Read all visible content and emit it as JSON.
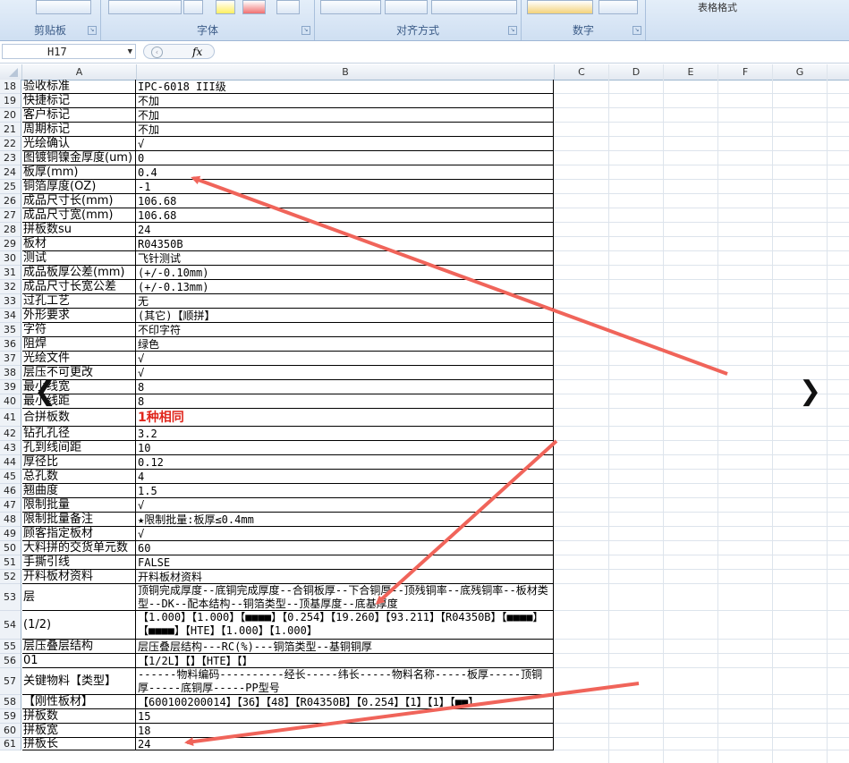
{
  "ribbon": {
    "groups": [
      {
        "label": "剪贴板"
      },
      {
        "label": "字体"
      },
      {
        "label": "对齐方式"
      },
      {
        "label": "数字"
      },
      {
        "label": "表格格式"
      }
    ]
  },
  "formula_bar": {
    "name_box": "H17",
    "fx_label": "fx",
    "value": ""
  },
  "columns": [
    "A",
    "B",
    "C",
    "D",
    "E",
    "F",
    "G"
  ],
  "rows": [
    {
      "num": "18",
      "a": "验收标准",
      "b": "IPC-6018 III级"
    },
    {
      "num": "19",
      "a": "快捷标记",
      "b": "不加"
    },
    {
      "num": "20",
      "a": "客户标记",
      "b": "不加"
    },
    {
      "num": "21",
      "a": "周期标记",
      "b": "不加"
    },
    {
      "num": "22",
      "a": "光绘确认",
      "b": "√"
    },
    {
      "num": "23",
      "a": "图镀铜镍金厚度(um)",
      "b": "0"
    },
    {
      "num": "24",
      "a": "板厚(mm)",
      "b": "0.4"
    },
    {
      "num": "25",
      "a": "铜箔厚度(OZ)",
      "b": "-1"
    },
    {
      "num": "26",
      "a": "成品尺寸长(mm)",
      "b": "106.68"
    },
    {
      "num": "27",
      "a": "成品尺寸宽(mm)",
      "b": "106.68"
    },
    {
      "num": "28",
      "a": "拼板数su",
      "b": "24"
    },
    {
      "num": "29",
      "a": "板材",
      "b": "R04350B"
    },
    {
      "num": "30",
      "a": "测试",
      "b": "飞针测试"
    },
    {
      "num": "31",
      "a": "成品板厚公差(mm)",
      "b": "(+/-0.10mm)"
    },
    {
      "num": "32",
      "a": "成品尺寸长宽公差",
      "b": "(+/-0.13mm)"
    },
    {
      "num": "33",
      "a": "过孔工艺",
      "b": "无"
    },
    {
      "num": "34",
      "a": "外形要求",
      "b": "(其它)【顺拼】"
    },
    {
      "num": "35",
      "a": "字符",
      "b": "不印字符"
    },
    {
      "num": "36",
      "a": "阻焊",
      "b": "绿色"
    },
    {
      "num": "37",
      "a": "光绘文件",
      "b": "√"
    },
    {
      "num": "38",
      "a": "层压不可更改",
      "b": "√"
    },
    {
      "num": "39",
      "a": "最小线宽",
      "b": "8"
    },
    {
      "num": "40",
      "a": "最小线距",
      "b": "8"
    },
    {
      "num": "41",
      "a": "合拼板数",
      "b": "1种相同"
    },
    {
      "num": "42",
      "a": "钻孔孔径",
      "b": "3.2"
    },
    {
      "num": "43",
      "a": "孔到线间距",
      "b": "10"
    },
    {
      "num": "44",
      "a": "厚径比",
      "b": "0.12"
    },
    {
      "num": "45",
      "a": "总孔数",
      "b": "4"
    },
    {
      "num": "46",
      "a": "翘曲度",
      "b": "1.5"
    },
    {
      "num": "47",
      "a": "限制批量",
      "b": "√"
    },
    {
      "num": "48",
      "a": "限制批量备注",
      "b": "★限制批量:板厚≤0.4mm"
    },
    {
      "num": "49",
      "a": "顾客指定板材",
      "b": "√"
    },
    {
      "num": "50",
      "a": "大料拼的交货单元数",
      "b": "60"
    },
    {
      "num": "51",
      "a": "手撕引线",
      "b": "FALSE"
    },
    {
      "num": "52",
      "a": "开料板材资料",
      "b": "开料板材资料"
    },
    {
      "num": "53",
      "a": "层",
      "b": "顶铜完成厚度--底铜完成厚度--合铜板厚--下合铜厚--顶残铜率--底残铜率--板材类型--DK--配本结构--铜箔类型--顶基厚度--底基厚度"
    },
    {
      "num": "54",
      "a": "(1/2)",
      "b": "【1.000】【1.000】【■■■■】【0.254】【19.260】【93.211】【R04350B】【■■■■】【■■■■】【HTE】【1.000】【1.000】"
    },
    {
      "num": "55",
      "a": "层压叠层结构",
      "b": "层压叠层结构---RC(%)---铜箔类型--基铜铜厚"
    },
    {
      "num": "56",
      "a": "01",
      "b": "【1/2L】【】【HTE】【】"
    },
    {
      "num": "57",
      "a": "关键物料【类型】",
      "b": "------物料编码----------经长-----纬长-----物料名称-----板厚-----顶铜厚-----底铜厚-----PP型号"
    },
    {
      "num": "58",
      "a": "【刚性板材】",
      "b": "【600100200014】【36】【48】【R04350B】【0.254】【1】【1】【■■】"
    },
    {
      "num": "59",
      "a": "拼板数",
      "b": "15"
    },
    {
      "num": "60",
      "a": "拼板宽",
      "b": "18"
    },
    {
      "num": "61",
      "a": "拼板长",
      "b": "24"
    }
  ],
  "colors": {
    "arrow": "#f0645a",
    "highlight_red": "#e0251b"
  }
}
